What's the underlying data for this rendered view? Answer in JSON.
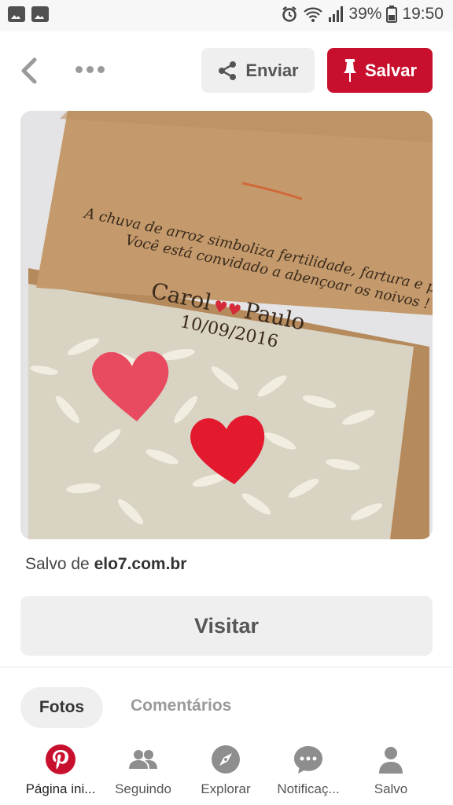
{
  "status_bar": {
    "battery": "39%",
    "time": "19:50"
  },
  "header": {
    "send_label": "Enviar",
    "save_label": "Salvar"
  },
  "pin": {
    "card_line1": "A chuva de arroz simboliza fertilidade, fartura e prosperidade.",
    "card_line2": "Você está convidado a abençoar os noivos !",
    "name_left": "Carol",
    "name_right": "Paulo",
    "date": "10/09/2016",
    "saved_prefix": "Salvo de ",
    "saved_source": "elo7.com.br",
    "visit_label": "Visitar"
  },
  "tabs": [
    {
      "label": "Fotos",
      "active": true
    },
    {
      "label": "Comentários",
      "active": false
    }
  ],
  "bottom_nav": [
    {
      "label": "Página ini...",
      "icon": "pinterest-icon"
    },
    {
      "label": "Seguindo",
      "icon": "people-icon"
    },
    {
      "label": "Explorar",
      "icon": "compass-icon"
    },
    {
      "label": "Notificaç...",
      "icon": "chat-bubble-icon"
    },
    {
      "label": "Salvo",
      "icon": "person-icon"
    }
  ],
  "colors": {
    "brand_red": "#c8102e",
    "button_gray": "#efefef"
  }
}
